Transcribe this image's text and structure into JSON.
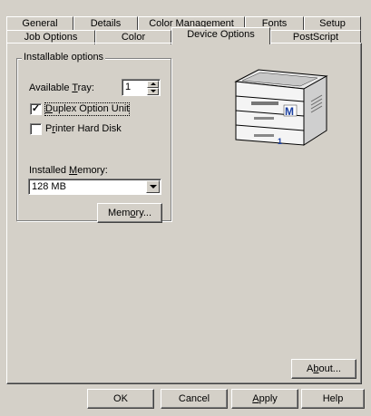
{
  "tabs_row1": [
    "General",
    "Details",
    "Color Management",
    "Fonts",
    "Setup"
  ],
  "tabs_row2": [
    "Job Options",
    "Color",
    "Device Options",
    "PostScript"
  ],
  "active_tab": "Device Options",
  "group": {
    "title": "Installable options",
    "tray_label_pre": "Available ",
    "tray_label_key": "T",
    "tray_label_post": "ray:",
    "tray_value": "1",
    "duplex_key": "D",
    "duplex_rest": "uplex Option Unit",
    "duplex_checked": true,
    "harddisk_pre": "P",
    "harddisk_key": "r",
    "harddisk_rest": "inter Hard Disk",
    "harddisk_checked": false,
    "memory_label_pre": "Installed ",
    "memory_label_key": "M",
    "memory_label_post": "emory:",
    "memory_value": "128 MB",
    "memory_button_pre": "Mem",
    "memory_button_key": "o",
    "memory_button_post": "ry..."
  },
  "printer_image": {
    "icon": "printer-icon",
    "badge_letter": "M",
    "tray_number": "1"
  },
  "about_button": {
    "pre": "A",
    "key": "b",
    "post": "out..."
  },
  "footer": {
    "ok": "OK",
    "cancel": "Cancel",
    "apply_key": "A",
    "apply_rest": "pply",
    "help": "Help"
  }
}
